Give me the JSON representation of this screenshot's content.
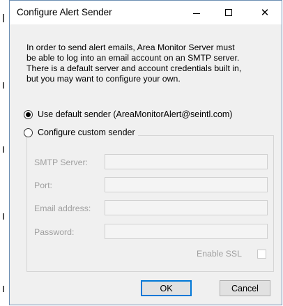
{
  "window": {
    "title": "Configure Alert Sender",
    "close_glyph": "✕"
  },
  "intro_lines": [
    "In order to send alert emails, Area Monitor Server must",
    "be able to log into an email account on an SMTP server.",
    "There is a default server and account credentials built in,",
    "but you may want to configure your own."
  ],
  "options": {
    "default_sender_label": "Use default sender (AreaMonitorAlert@seintl.com)",
    "default_sender_selected": true,
    "custom_sender_label": "Configure custom sender",
    "custom_sender_selected": false
  },
  "custom_sender": {
    "smtp_server_label": "SMTP Server:",
    "smtp_server_value": "",
    "port_label": "Port:",
    "port_value": "",
    "email_label": "Email address:",
    "email_value": "",
    "password_label": "Password:",
    "password_value": "",
    "enable_ssl_label": "Enable SSL",
    "enable_ssl_checked": false
  },
  "buttons": {
    "ok_label": "OK",
    "cancel_label": "Cancel"
  },
  "colors": {
    "dialog_background": "#f0f0f0",
    "disabled_text": "#a0a0a0",
    "default_button_accent": "#0078d7"
  },
  "icons": {
    "minimize": "minimize-icon",
    "maximize": "maximize-icon",
    "close": "close-icon"
  }
}
